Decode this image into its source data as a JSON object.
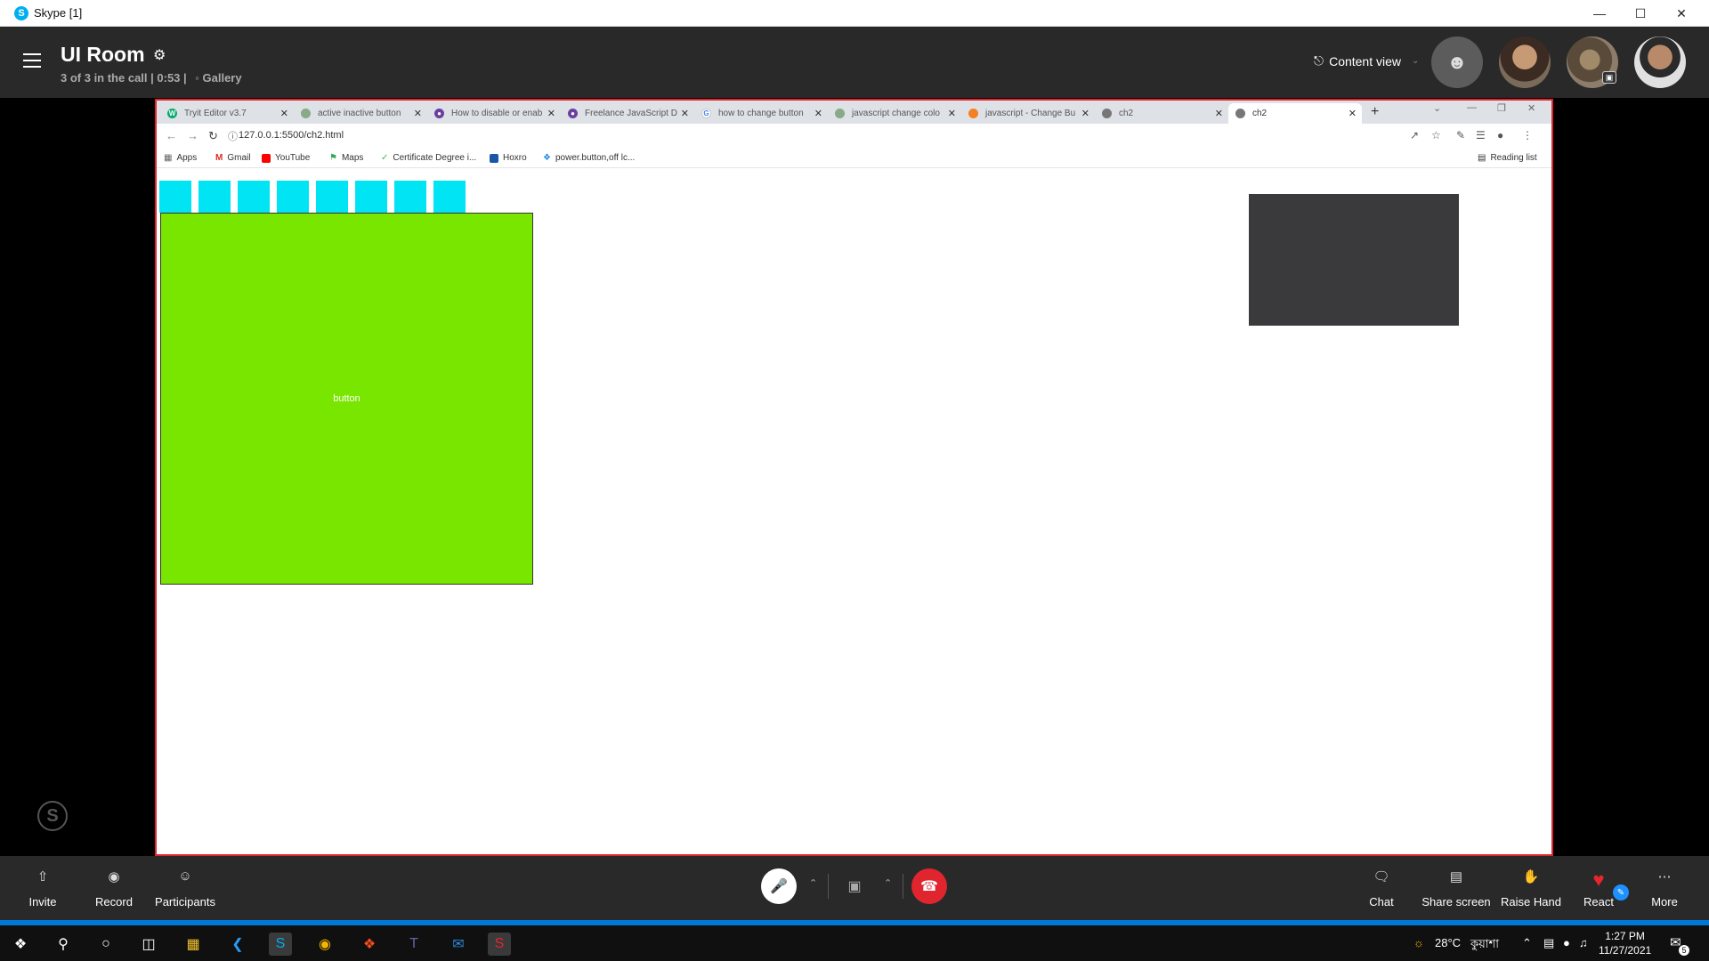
{
  "window": {
    "title": "Skype [1]"
  },
  "call": {
    "room_title": "UI Room",
    "subtitle": "3 of 3 in the call | 0:53 |",
    "view_mode": "Gallery",
    "content_view": "Content view"
  },
  "browser": {
    "tabs": [
      {
        "label": "Tryit Editor v3.7"
      },
      {
        "label": "active inactive button"
      },
      {
        "label": "How to disable or enab"
      },
      {
        "label": "Freelance JavaScript D"
      },
      {
        "label": "how to change button"
      },
      {
        "label": "javascript change colo"
      },
      {
        "label": "javascript - Change Bu"
      },
      {
        "label": "ch2"
      },
      {
        "label": "ch2"
      }
    ],
    "url": "127.0.0.1:5500/ch2.html",
    "bookmarks": [
      {
        "label": "Apps"
      },
      {
        "label": "Gmail"
      },
      {
        "label": "YouTube"
      },
      {
        "label": "Maps"
      },
      {
        "label": "Certificate Degree i..."
      },
      {
        "label": "Hoxro"
      },
      {
        "label": "power.button,off lc..."
      }
    ],
    "reading_list": "Reading list"
  },
  "page": {
    "green_button_label": "button"
  },
  "controls": {
    "invite": "Invite",
    "record": "Record",
    "participants": "Participants",
    "chat": "Chat",
    "share_screen": "Share screen",
    "raise_hand": "Raise Hand",
    "react": "React",
    "more": "More"
  },
  "taskbar": {
    "weather": "28°C",
    "weather_text": "কুয়াশা",
    "time": "1:27 PM",
    "date": "11/27/2021",
    "notification_count": "5"
  },
  "colors": {
    "accent_red": "#e0252f",
    "cyan": "#00e4f4",
    "green": "#79e600",
    "skype_blue": "#00aff0"
  }
}
